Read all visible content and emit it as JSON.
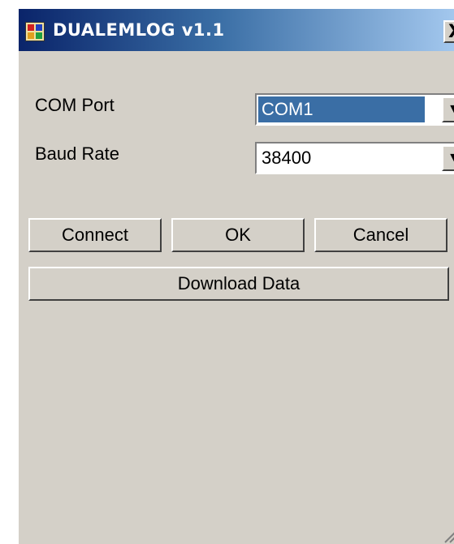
{
  "window": {
    "title": "DUALEMLOG v1.1",
    "close_label": "X"
  },
  "form": {
    "com_port_label": "COM Port",
    "com_port_value": "COM1",
    "baud_rate_label": "Baud Rate",
    "baud_rate_value": "38400"
  },
  "buttons": {
    "connect": "Connect",
    "ok": "OK",
    "cancel": "Cancel",
    "download": "Download Data"
  },
  "icons": {
    "app": "app-icon",
    "close": "close-icon",
    "dropdown": "chevron-down-icon",
    "grip": "resize-grip-icon"
  },
  "colors": {
    "window_bg": "#d4d0c8",
    "titlebar_start": "#0a246a",
    "titlebar_end": "#a6caf0",
    "selection": "#3a6ea5"
  }
}
